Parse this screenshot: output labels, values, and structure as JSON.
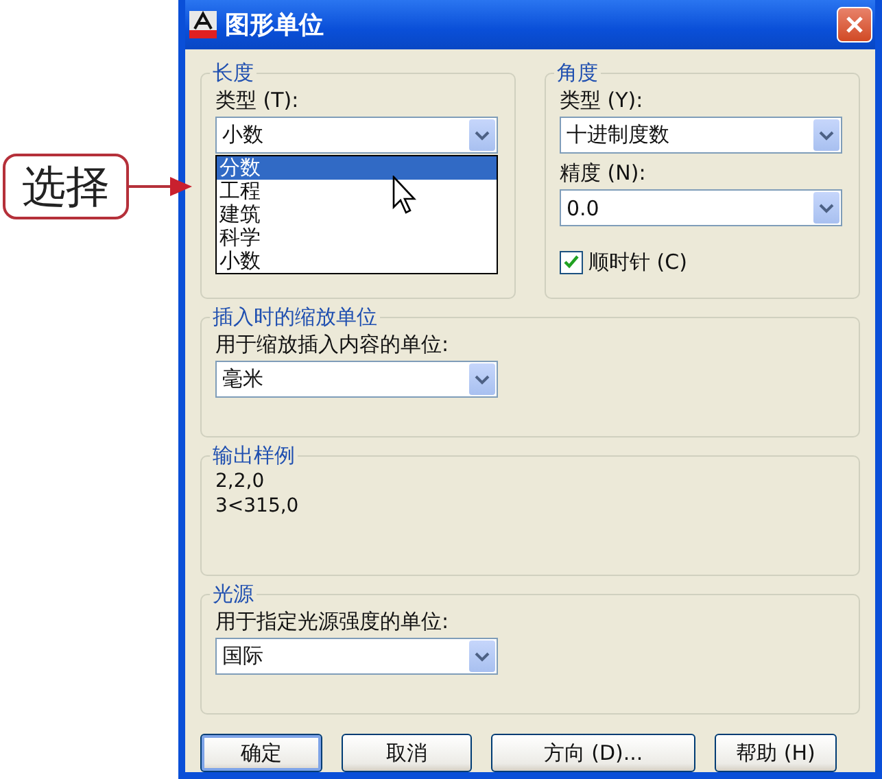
{
  "callout": {
    "label": "选择"
  },
  "window": {
    "title": "图形单位"
  },
  "length": {
    "title": "长度",
    "type_label": "类型 (T):",
    "type_value": "小数",
    "expanded": true,
    "options": [
      {
        "label": "分数",
        "selected": true
      },
      {
        "label": "工程",
        "selected": false
      },
      {
        "label": "建筑",
        "selected": false
      },
      {
        "label": "科学",
        "selected": false
      },
      {
        "label": "小数",
        "selected": false
      }
    ]
  },
  "angle": {
    "title": "角度",
    "type_label": "类型 (Y):",
    "type_value": "十进制度数",
    "precision_label": "精度 (N):",
    "precision_value": "0.0",
    "clockwise": {
      "label": "顺时针 (C)",
      "checked": true
    }
  },
  "insertion_scale": {
    "title": "插入时的缩放单位",
    "label": "用于缩放插入内容的单位:",
    "value": "毫米"
  },
  "sample_output": {
    "title": "输出样例",
    "lines": [
      "2,2,0",
      "3<315,0"
    ]
  },
  "lighting": {
    "title": "光源",
    "label": "用于指定光源强度的单位:",
    "value": "国际"
  },
  "buttons": [
    {
      "label": "确定",
      "default": true
    },
    {
      "label": "取消",
      "default": false
    },
    {
      "label": "方向 (D)...",
      "default": false
    },
    {
      "label": "帮助 (H)",
      "default": false
    }
  ]
}
